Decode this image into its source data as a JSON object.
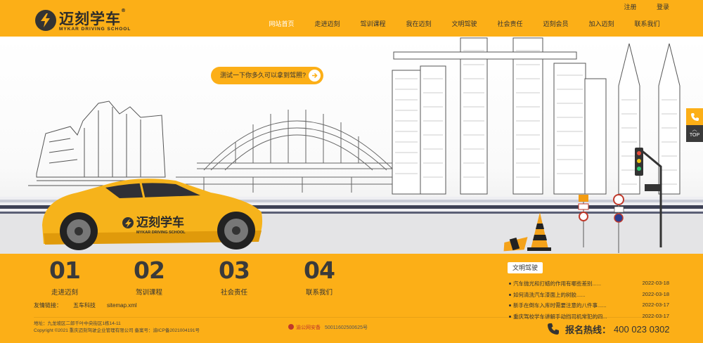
{
  "brand": {
    "name": "迈刻学车",
    "sub": "MYKAR DRIVING SCHOOL"
  },
  "auth": {
    "register": "注册",
    "login": "登录"
  },
  "nav": [
    "网站首页",
    "走进迈刻",
    "驾训课程",
    "我在迈刻",
    "文明驾驶",
    "社会责任",
    "迈刻会员",
    "加入迈刻",
    "联系我们"
  ],
  "banner": {
    "cta": "测试一下你多久可以拿到驾照?",
    "car_brand": "迈刻学车",
    "car_sub": "MYKAR DRIVING SCHOOL"
  },
  "side": {
    "top_label": "TOP"
  },
  "features": [
    {
      "num": "01",
      "label": "走进迈刻"
    },
    {
      "num": "02",
      "label": "驾训课程"
    },
    {
      "num": "03",
      "label": "社会责任"
    },
    {
      "num": "04",
      "label": "联系我们"
    }
  ],
  "links": {
    "label": "友情链接：",
    "items": [
      "五车科技",
      "sitemap.xml"
    ]
  },
  "news": {
    "tab": "文明驾驶",
    "items": [
      {
        "title": "汽车抛光和打蜡的作用有哪些差别......",
        "date": "2022-03-18"
      },
      {
        "title": "如何清洗汽车漆面上的树胶......",
        "date": "2022-03-18"
      },
      {
        "title": "新手在倒车入库时需要注意的八件事......",
        "date": "2022-03-17"
      },
      {
        "title": "重庆驾校学车讲解手动挡司机常犯的四...",
        "date": "2022-03-17"
      }
    ]
  },
  "footer": {
    "address": "地址：九龙坡区二郎千叶中央街区1栋14-11",
    "copyright": "Copyright ©2021 重庆迈刻驾驶企业管理有限公司 备案号：渝ICP备2021004191号",
    "police_label": "渝公网安备",
    "police_num": "50011602500625号",
    "hotline_label": "报名热线：",
    "hotline_number": "400 023 0302"
  },
  "colors": {
    "accent": "#fcaf17",
    "dark": "#333333"
  }
}
